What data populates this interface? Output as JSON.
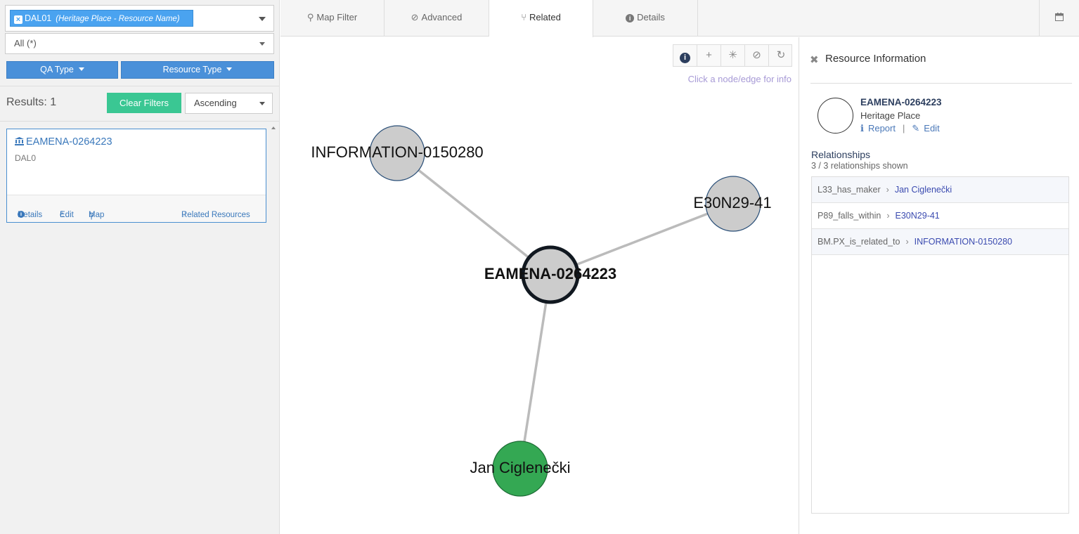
{
  "search": {
    "token_code": "DAL01",
    "token_sub": "(Heritage Place - Resource Name)",
    "scope": "All (*)"
  },
  "filters": {
    "qa_type": "QA Type",
    "resource_type": "Resource Type"
  },
  "results": {
    "count_label": "Results: 1",
    "clear_label": "Clear Filters",
    "sort_label": "Ascending",
    "items": [
      {
        "title": "EAMENA-0264223",
        "subtitle": "DAL0",
        "details": "Details",
        "edit": "Edit",
        "map": "Map",
        "related": "Related Resources"
      }
    ]
  },
  "tabs": {
    "map_filter": "Map Filter",
    "advanced": "Advanced",
    "related": "Related",
    "details": "Details"
  },
  "graph": {
    "hint": "Click a node/edge for info",
    "nodes": [
      {
        "id": "center",
        "label": "EAMENA-0264223",
        "color": "#cccccc",
        "focused": true
      },
      {
        "id": "info",
        "label": "INFORMATION-0150280",
        "color": "#cccccc"
      },
      {
        "id": "grid",
        "label": "E30N29-41",
        "color": "#cccccc"
      },
      {
        "id": "person",
        "label": "Jan Ciglenečki",
        "color": "#34a853"
      }
    ]
  },
  "resource_info": {
    "title": "Resource Information",
    "name": "EAMENA-0264223",
    "type": "Heritage Place",
    "report": "Report",
    "edit": "Edit",
    "relationships_title": "Relationships",
    "relationships_count": "3 / 3 relationships shown",
    "relationships": [
      {
        "predicate": "L33_has_maker",
        "object": "Jan Ciglenečki"
      },
      {
        "predicate": "P89_falls_within",
        "object": "E30N29-41"
      },
      {
        "predicate": "BM.PX_is_related_to",
        "object": "INFORMATION-0150280"
      }
    ]
  },
  "colors": {
    "accent": "#4a90d9",
    "clear_button": "#3ac793",
    "link": "#3a78bb",
    "node_gray": "#cccccc",
    "node_green": "#34a853"
  }
}
